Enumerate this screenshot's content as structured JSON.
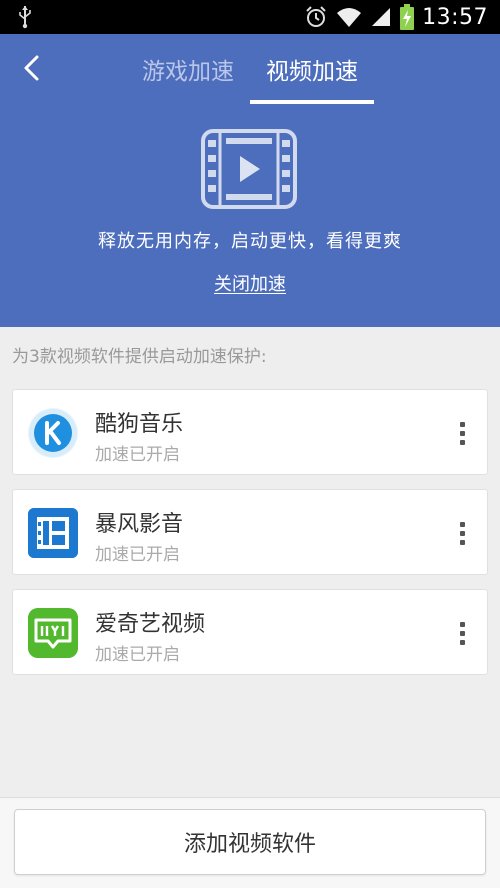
{
  "status_bar": {
    "time": "13:57",
    "icons": [
      "usb-icon",
      "alarm-icon",
      "wifi-icon",
      "signal-icon",
      "battery-charging-icon"
    ]
  },
  "header": {
    "back_icon": "back-arrow-icon",
    "tabs": [
      {
        "label": "游戏加速",
        "active": false
      },
      {
        "label": "视频加速",
        "active": true
      }
    ],
    "hero_icon": "film-strip-play-icon",
    "tagline": "释放无用内存，启动更快，看得更爽",
    "close_link": "关闭加速"
  },
  "section": {
    "label": "为3款视频软件提供启动加速保护:"
  },
  "apps": [
    {
      "name": "酷狗音乐",
      "status": "加速已开启",
      "icon": "kugou-app-icon",
      "color": "#1f8fe0"
    },
    {
      "name": "暴风影音",
      "status": "加速已开启",
      "icon": "baofeng-app-icon",
      "color": "#1d79cf"
    },
    {
      "name": "爱奇艺视频",
      "status": "加速已开启",
      "icon": "iqiyi-app-icon",
      "color": "#52b82e"
    }
  ],
  "bottom": {
    "add_label": "添加视频软件"
  },
  "colors": {
    "header_bg": "#4d6dbd",
    "page_bg": "#eeeeee"
  }
}
